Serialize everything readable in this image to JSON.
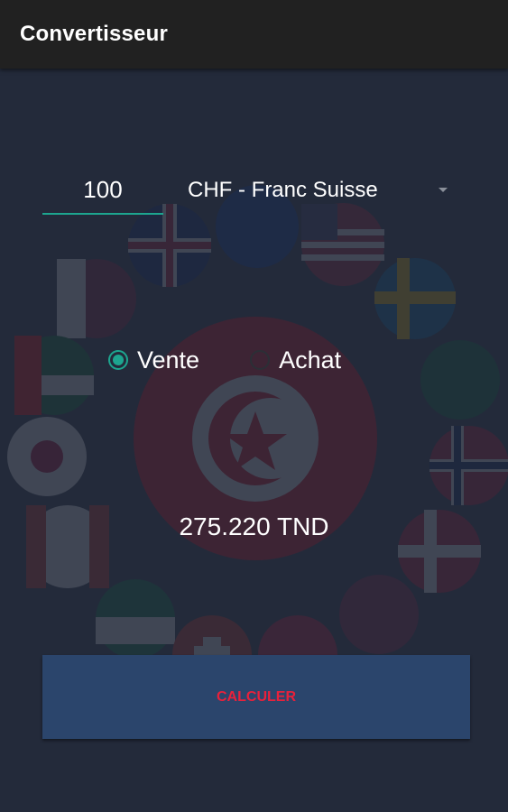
{
  "appbar": {
    "title": "Convertisseur"
  },
  "form": {
    "amount_value": "100",
    "currency_selected": "CHF - Franc Suisse",
    "radio": {
      "sell_label": "Vente",
      "buy_label": "Achat",
      "selected": "Vente"
    },
    "result": "275.220 TND",
    "calculate_label": "CALCULER"
  },
  "colors": {
    "appbar_bg": "#212121",
    "content_bg": "#232a3a",
    "accent": "#1da58f",
    "button_bg": "#2b456c",
    "button_text": "#e8213b"
  },
  "icons": {
    "dropdown": "chevron-down-icon",
    "radio_on": "radio-checked-icon",
    "radio_off": "radio-unchecked-icon"
  },
  "background_image": "faded-flags-circle-around-tunisia-flag"
}
